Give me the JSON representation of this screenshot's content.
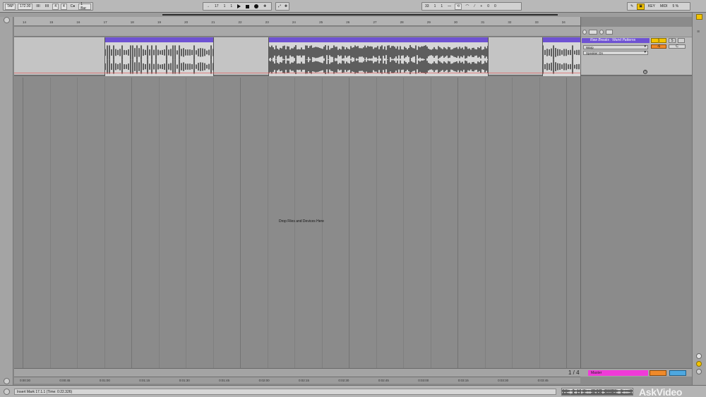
{
  "control_bar": {
    "tap_label": "TAP",
    "tempo": "172.00",
    "nudge_down": "IIII",
    "nudge_up": "IIII",
    "time_sig_num": "4",
    "time_sig_den": "4",
    "metronome": "C●",
    "quantize": "1 Bar",
    "follow_arrow": "→",
    "position_bar": "17",
    "position_beat": "1",
    "position_sixteenth": "1",
    "loop_start_bar": "33",
    "loop_start_beat": "1",
    "loop_start_sixteenth": "1",
    "punch_glyph": "⁓",
    "loop_glyph": "⟲",
    "draw_mode_plus": "+",
    "loop_len_beat": "0",
    "loop_len_sixteenth": "0",
    "key_label": "KEY",
    "midi_label": "MIDI",
    "cpu_label": "5 %"
  },
  "ruler": {
    "bars": [
      "14",
      "15",
      "16",
      "17",
      "18",
      "19",
      "20",
      "21",
      "22",
      "23",
      "24",
      "25",
      "26",
      "27",
      "28",
      "29",
      "30",
      "31",
      "32",
      "33",
      "34"
    ]
  },
  "track": {
    "name": "Raw Breaks : Weird Patterns",
    "warp_mode": "Warp",
    "monitor": "Speaker On",
    "number": "1",
    "solo": "S",
    "volume": "-6",
    "pan": "C",
    "io_glyph": "⊙"
  },
  "arrangement": {
    "drop_text": "Drop Files and Devices Here"
  },
  "master": {
    "name": "Master",
    "zoom": "1 / 4"
  },
  "time_ruler": {
    "ticks": [
      "0:00:30",
      "0:00:45",
      "0:01:00",
      "0:01:15",
      "0:01:30",
      "0:01:45",
      "0:02:00",
      "0:02:15",
      "0:02:30",
      "0:02:45",
      "0:03:00",
      "0:03:15",
      "0:03:30",
      "0:03:45"
    ]
  },
  "status_bar": {
    "text": "Insert Mark 17.1.1 (Time: 0:22.326)"
  },
  "watermark": {
    "text": "AskVideo"
  },
  "colors": {
    "clip_header": "#6e52d3",
    "track_number": "#f3c400",
    "master_track": "#f03ad8",
    "volume": "#f08a2a",
    "pan_master": "#4ea8e0"
  }
}
